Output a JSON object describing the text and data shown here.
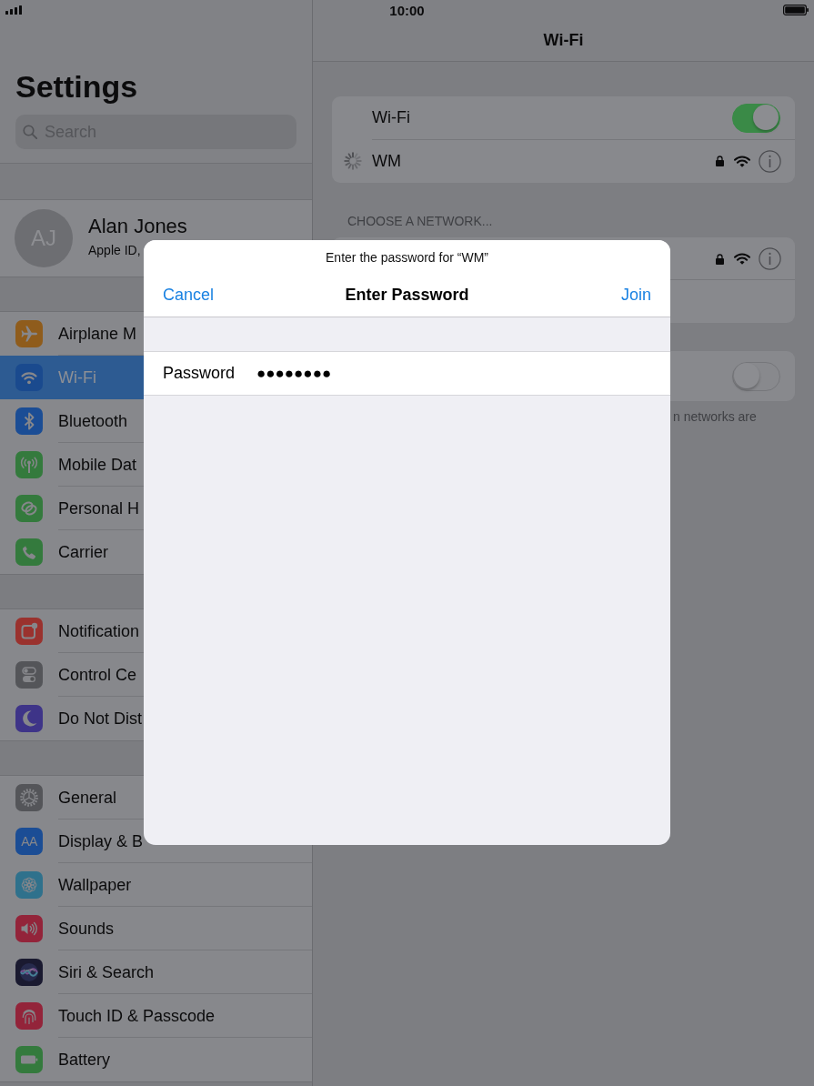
{
  "status_bar": {
    "time": "10:00"
  },
  "sidebar": {
    "title": "Settings",
    "search": {
      "placeholder": "Search"
    },
    "profile": {
      "initials": "AJ",
      "name": "Alan Jones",
      "subtitle": "Apple ID,"
    },
    "groups": [
      {
        "items": [
          {
            "label": "Airplane M",
            "color": "#8f5c1c",
            "selected": false
          },
          {
            "label": "Wi-Fi",
            "color": "#1a4a8e",
            "selected": true
          },
          {
            "label": "Bluetooth",
            "color": "#1b4d95",
            "selected": false
          },
          {
            "label": "Mobile Dat",
            "color": "#347a3d",
            "selected": false
          },
          {
            "label": "Personal H",
            "color": "#347a3d",
            "selected": false
          },
          {
            "label": "Carrier",
            "color": "#347a3d",
            "selected": false
          }
        ]
      },
      {
        "items": [
          {
            "label": "Notification",
            "color": "#9a322e",
            "selected": false
          },
          {
            "label": "Control Ce",
            "color": "#545559",
            "selected": false
          },
          {
            "label": "Do Not Dist",
            "color": "#3e3488",
            "selected": false
          }
        ]
      },
      {
        "items": [
          {
            "label": "General",
            "color": "#545559",
            "selected": false
          },
          {
            "label": "Display & B",
            "color": "#1b4d95",
            "icon_text": "AA",
            "selected": false
          },
          {
            "label": "Wallpaper",
            "color": "#2f718c",
            "selected": false
          },
          {
            "label": "Sounds",
            "color": "#93243a",
            "selected": false
          },
          {
            "label": "Siri & Search",
            "color": "#1a1a30",
            "selected": false
          },
          {
            "label": "Touch ID & Passcode",
            "color": "#93243a",
            "selected": false
          },
          {
            "label": "Battery",
            "color": "#347a3d",
            "selected": false
          }
        ]
      }
    ]
  },
  "detail": {
    "title": "Wi-Fi",
    "groups": [
      {
        "rows": [
          {
            "kind": "toggle",
            "label": "Wi-Fi",
            "on": true
          },
          {
            "kind": "network",
            "label": "WM",
            "connecting": true,
            "secured": true
          }
        ]
      },
      {
        "header": "CHOOSE A NETWORK...",
        "rows": [
          {
            "kind": "network",
            "connecting": false,
            "secured": true
          }
        ]
      },
      {
        "rows": [
          {
            "kind": "toggle",
            "on": false
          }
        ],
        "footer": "n networks are"
      }
    ]
  },
  "dialog": {
    "message": "Enter the password for “WM”",
    "cancel": "Cancel",
    "title": "Enter Password",
    "join": "Join",
    "field": {
      "label": "Password",
      "value": "●●●●●●●●"
    }
  }
}
